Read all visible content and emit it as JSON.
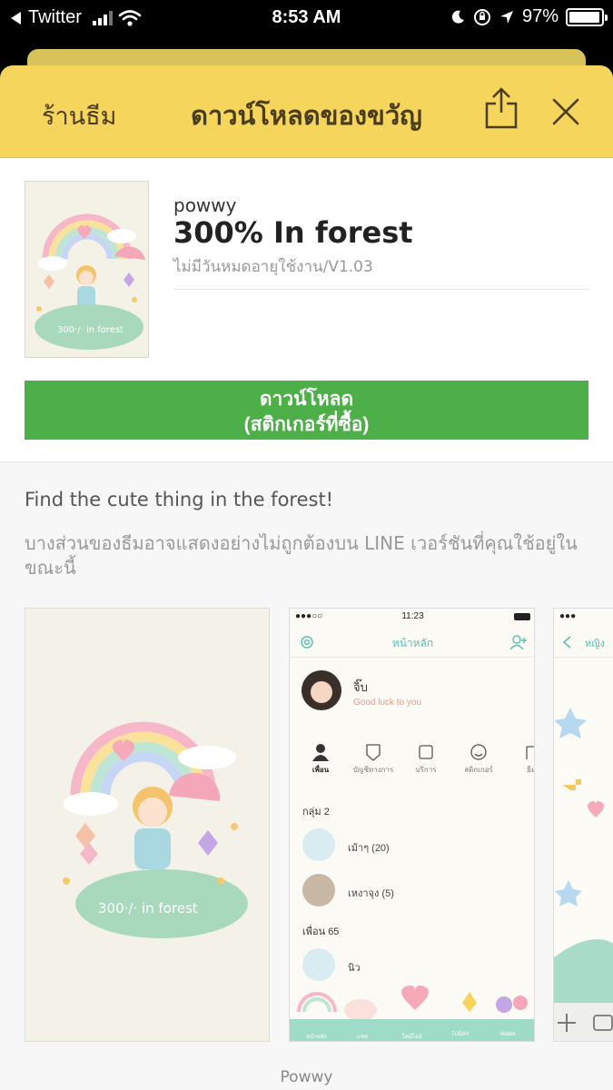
{
  "status_bar": {
    "back_app": "Twitter",
    "time": "8:53 AM",
    "battery": "97%",
    "battery_level": 0.97
  },
  "header": {
    "store_label": "ร้านธีม",
    "title": "ดาวน์โหลดของขวัญ"
  },
  "product": {
    "author": "powwy",
    "name": "300% In forest",
    "meta": "ไม่มีวันหมดอายุใช้งาน/V1.03",
    "thumb_text": "300·/· in forest"
  },
  "download_button": {
    "line1": "ดาวน์โหลด",
    "line2": "(สติกเกอร์ที่ซื้อ)"
  },
  "description": "Find the cute thing in the forest!",
  "note": "บางส่วนของธีมอาจแสดงอย่างไม่ถูกต้องบน LINE เวอร์ชันที่คุณใช้อยู่ในขณะนี้",
  "screenshot1": {
    "text": "300·/· in forest"
  },
  "screenshot2": {
    "time": "11:23",
    "nav_title": "หน้าหลัก",
    "profile_name": "จิ๊บ",
    "profile_status": "Good luck to you",
    "tabs": [
      "เพื่อน",
      "บัญชีทางการ",
      "บริการ",
      "สติกเกอร์",
      "ธีม"
    ],
    "group_section": "กลุ่ม 2",
    "groups": [
      "เม้าๆ (20)",
      "เหงาจุง (5)"
    ],
    "friend_section": "เพื่อน 65",
    "friends": [
      "นิว"
    ],
    "bottom_tabs": [
      "หน้าหลัก",
      "แชท",
      "ไทม์ไลน์",
      "TODAY",
      "Wallet"
    ]
  },
  "screenshot3": {
    "nav_title": "หญิง"
  },
  "caption": "Powwy",
  "colors": {
    "header_bg": "#f5d55b",
    "download_green": "#4caf48",
    "accent_teal": "#5bbfb0"
  }
}
